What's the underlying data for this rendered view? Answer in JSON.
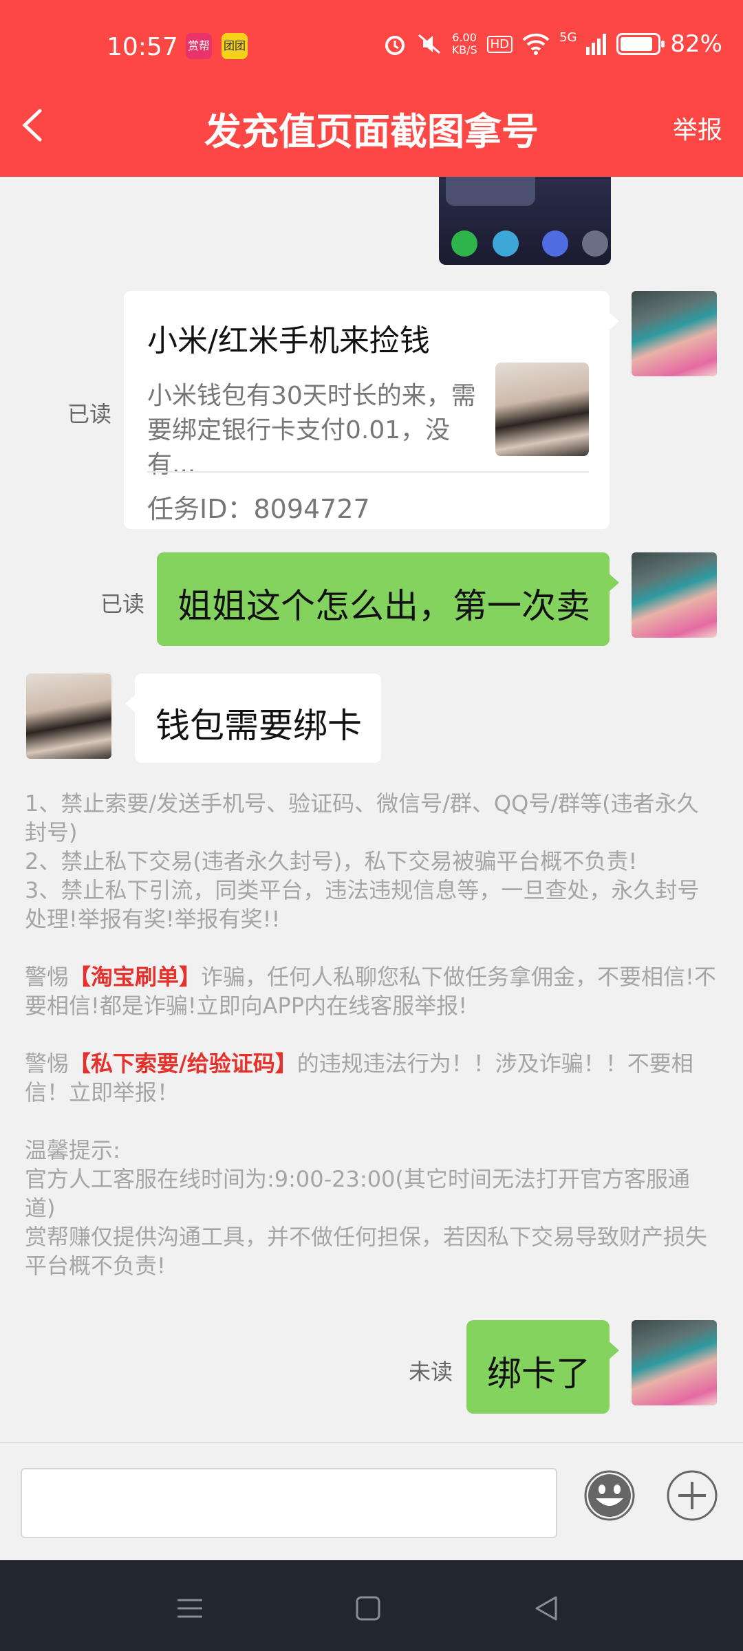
{
  "status_bar": {
    "time": "10:57",
    "app1_label": "赏帮",
    "app2_label": "团团",
    "speed_value": "6.00",
    "speed_unit": "KB/S",
    "hd": "HD",
    "network": "5G",
    "battery": "82%"
  },
  "header": {
    "title": "发充值页面截图拿号",
    "report": "举报",
    "bg_color": "#fd4744"
  },
  "messages": {
    "task_card": {
      "read_status": "已读",
      "title": "小米/红米手机来捡钱",
      "desc": "小米钱包有30天时长的来，需要绑定银行卡支付0.01，没有...",
      "task_id_label": "任务ID：",
      "task_id": "8094727"
    },
    "msg1": {
      "read_status": "已读",
      "text": "姐姐这个怎么出，第一次卖"
    },
    "msg2": {
      "text": "钱包需要绑卡"
    },
    "msg3": {
      "read_status": "未读",
      "text": "绑卡了"
    }
  },
  "notice": {
    "line1": "1、禁止索要/发送手机号、验证码、微信号/群、QQ号/群等(违者永久封号)",
    "line2": "2、禁止私下交易(违者永久封号)，私下交易被骗平台概不负责!",
    "line3": "3、禁止私下引流，同类平台，违法违规信息等，一旦查处，永久封号处理!举报有奖!举报有奖!!",
    "warn1_prefix": "警惕",
    "warn1_highlight": "【淘宝刷单】",
    "warn1_suffix": "诈骗，任何人私聊您私下做任务拿佣金，不要相信!不要相信!都是诈骗!立即向APP内在线客服举报!",
    "warn2_prefix": "警惕",
    "warn2_highlight": "【私下索要/给验证码】",
    "warn2_suffix": "的违规违法行为！！涉及诈骗！！不要相信！立即举报！",
    "tips_title": "温馨提示:",
    "tips_line1": "官方人工客服在线时间为:9:00-23:00(其它时间无法打开官方客服通道)",
    "tips_line2": "赏帮赚仅提供沟通工具，并不做任何担保，若因私下交易导致财产损失平台概不负责!"
  },
  "input": {
    "value": "",
    "placeholder": ""
  },
  "colors": {
    "accent": "#fd4744",
    "bubble_green": "#84d35f",
    "highlight_red": "#e6302b",
    "notice_text": "#a5a5a5"
  },
  "icons": [
    "back-arrow-icon",
    "alarm-icon",
    "mute-icon",
    "wifi-icon",
    "signal-icon",
    "battery-icon",
    "emoji-icon",
    "plus-icon",
    "menu-icon",
    "home-icon",
    "back-nav-icon"
  ]
}
